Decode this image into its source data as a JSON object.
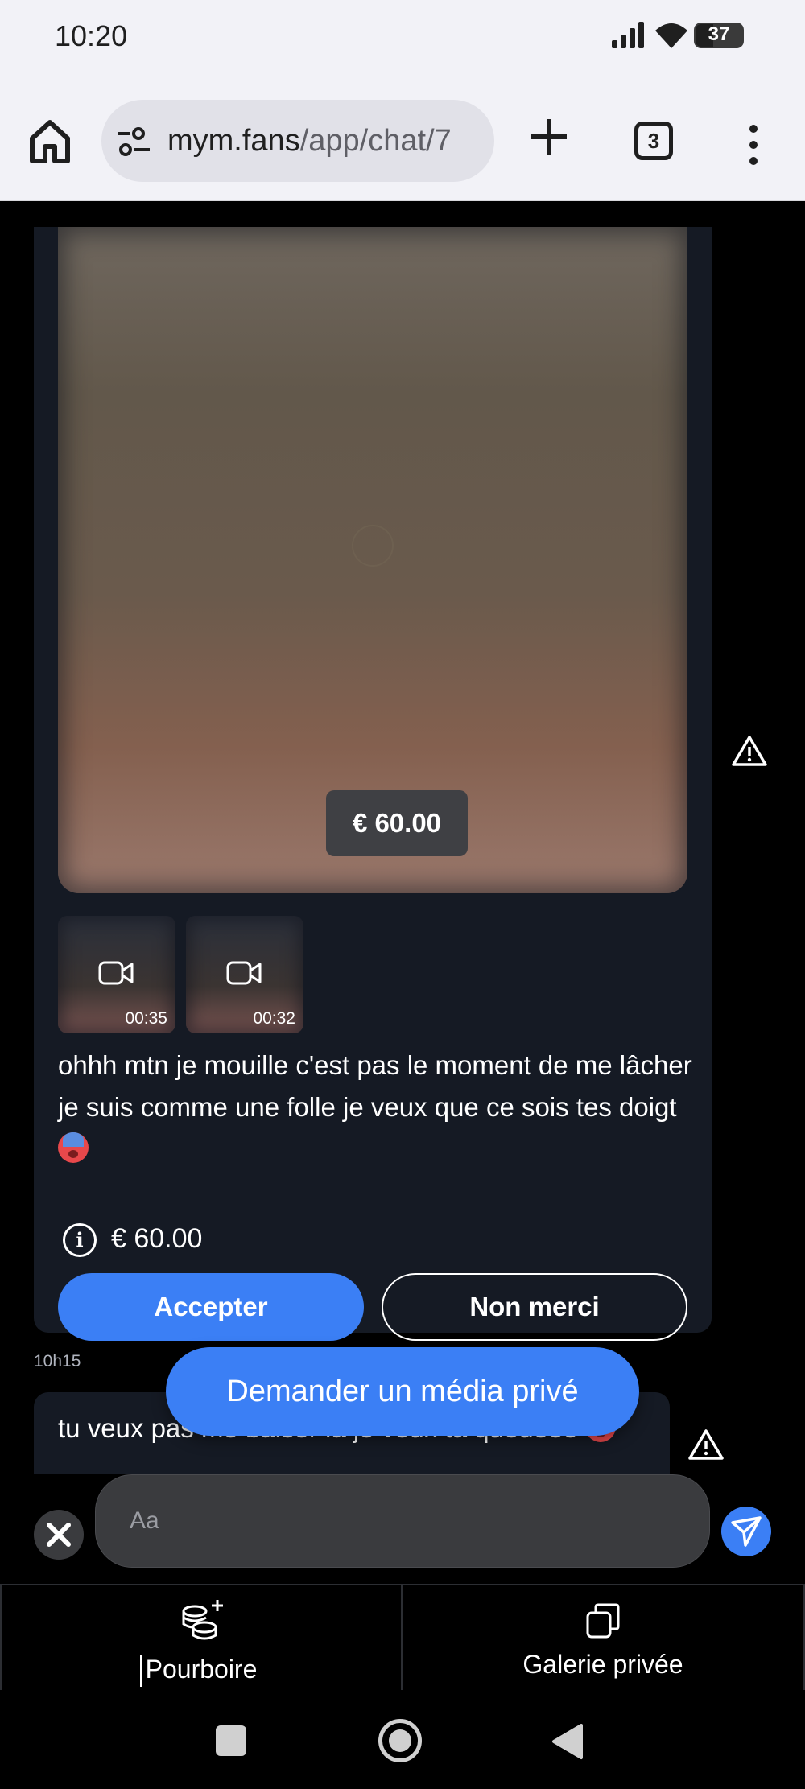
{
  "status_bar": {
    "time": "10:20",
    "battery": "37"
  },
  "browser": {
    "url_host": "mym.fans",
    "url_path": "/app/chat/7",
    "tab_count": "3"
  },
  "chat": {
    "media_offer": {
      "price_tag": "€ 60.00",
      "videos": [
        {
          "duration": "00:35"
        },
        {
          "duration": "00:32"
        }
      ],
      "message": "ohhh mtn je mouille c'est pas le moment de me lâcher je suis comme une folle je veux que ce sois tes doigt",
      "price_info": "€ 60.00",
      "accept_label": "Accepter",
      "decline_label": "Non merci"
    },
    "timestamp": "10h15",
    "second_message": "tu veux pas me baiser la je veux ta queueee",
    "request_media_label": "Demander un média privé",
    "input_placeholder": "Aa"
  },
  "bottom_tabs": {
    "tip_label": "Pourboire",
    "gallery_label": "Galerie privée"
  },
  "colors": {
    "accent": "#3b7ff5",
    "bubble": "#151a24",
    "input_bg": "#3a3b3e",
    "browser_bg": "#f2f2f7"
  },
  "icons": [
    "home-icon",
    "tune-icon",
    "plus-icon",
    "more-vert-icon",
    "video-icon",
    "info-icon",
    "warning-icon",
    "close-icon",
    "send-icon",
    "coins-plus-icon",
    "copy-icon"
  ]
}
